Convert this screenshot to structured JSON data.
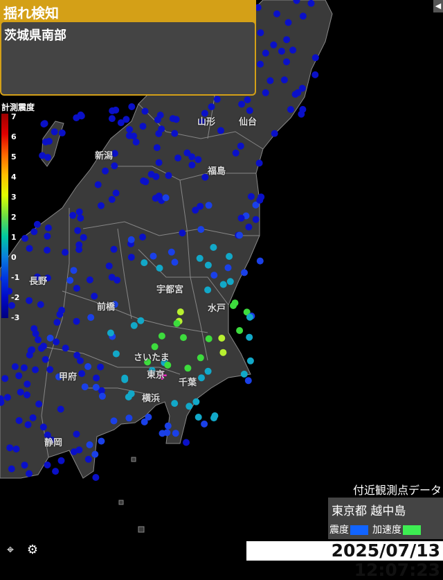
{
  "alert": {
    "title": "揺れ検知",
    "area": "茨城県南部",
    "color": "#d4a017"
  },
  "scale": {
    "title": "計測震度",
    "ticks": [
      "7",
      "6",
      "5",
      "4",
      "3",
      "2",
      "1",
      "0",
      "-1",
      "-2",
      "-3"
    ],
    "gradient": [
      "#9b0000",
      "#e00000",
      "#ff6600",
      "#ffc000",
      "#e0ff00",
      "#6ede43",
      "#00c8a0",
      "#0a7fdc",
      "#0038e0",
      "#0008c8",
      "#00007f"
    ]
  },
  "cities": [
    {
      "name": "山形"
    },
    {
      "name": "仙台"
    },
    {
      "name": "新潟"
    },
    {
      "name": "福島"
    },
    {
      "name": "長野"
    },
    {
      "name": "宇都宮"
    },
    {
      "name": "前橋"
    },
    {
      "name": "水戸"
    },
    {
      "name": "さいたま"
    },
    {
      "name": "甲府"
    },
    {
      "name": "東京"
    },
    {
      "name": "千葉"
    },
    {
      "name": "横浜"
    },
    {
      "name": "静岡"
    }
  ],
  "nearby": {
    "title": "付近観測点データ",
    "station": "東京都 越中島",
    "intensity_label": "震度",
    "intensity_color": "#1164ff",
    "acceleration_label": "加速度",
    "acceleration_color": "#3ded52"
  },
  "timestamp": "2025/07/13 12:07:23",
  "icons": {
    "locate": "locate-icon",
    "settings": "gear-icon",
    "collapse": "chevron-left-icon"
  },
  "station_colors": {
    "dark_blue": "#0a10c8",
    "blue": "#1a40e8",
    "cyan": "#12a8c8",
    "green": "#3ddc3d",
    "yellow": "#b8f030",
    "epicenter": "#ff2ad0"
  }
}
